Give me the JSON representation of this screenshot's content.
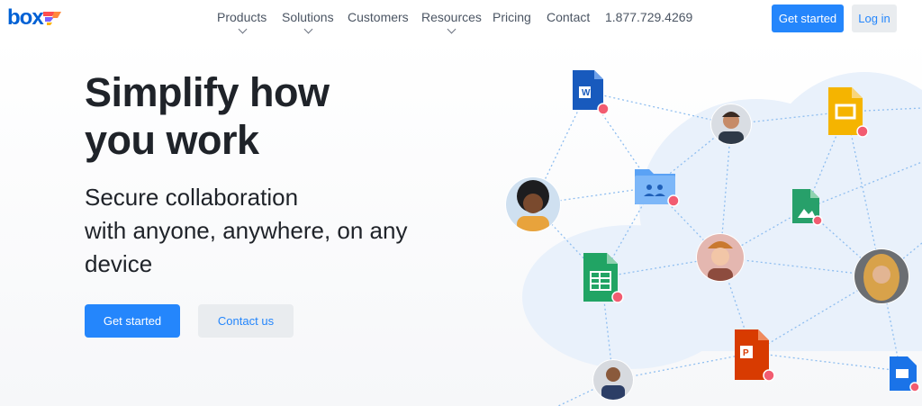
{
  "brand": {
    "logo_text": "box",
    "logo_colors": [
      "#0061d5",
      "#ff4d4f",
      "#7b61ff",
      "#ffb400"
    ]
  },
  "nav": {
    "items": [
      {
        "label": "Products",
        "has_dropdown": true
      },
      {
        "label": "Solutions",
        "has_dropdown": true
      },
      {
        "label": "Customers",
        "has_dropdown": false
      },
      {
        "label": "Resources",
        "has_dropdown": true
      },
      {
        "label": "Pricing",
        "has_dropdown": false
      },
      {
        "label": "Contact",
        "has_dropdown": false
      }
    ],
    "phone": "1.877.729.4269",
    "get_started_label": "Get started",
    "login_label": "Log in"
  },
  "hero": {
    "headline_line1": "Simplify how",
    "headline_line2": "you work",
    "subhead_line1": "Secure collaboration",
    "subhead_line2": "with anyone, anywhere, on any",
    "subhead_line3": "device",
    "primary_cta": "Get started",
    "secondary_cta": "Contact us"
  },
  "illustration": {
    "icons": [
      "word-doc-icon",
      "google-slides-icon",
      "shared-folder-icon",
      "image-file-icon",
      "google-sheets-icon",
      "powerpoint-icon",
      "keynote-icon",
      "lock-badge-icon"
    ],
    "avatars": 5,
    "colors": {
      "accent": "#2486fc",
      "cloud": "#e9f1fb",
      "lock_badge": "#f25c71"
    }
  }
}
